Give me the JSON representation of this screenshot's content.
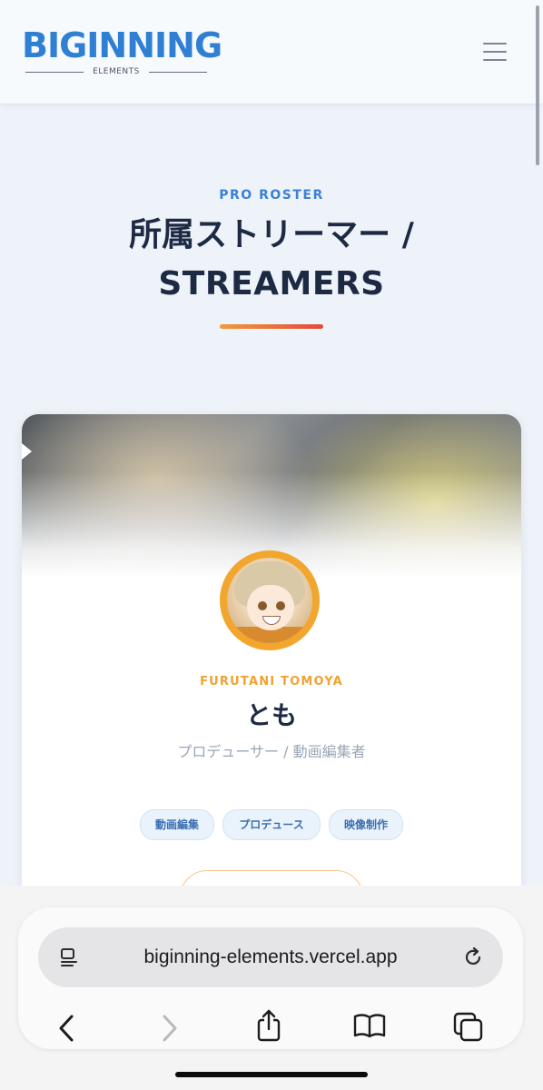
{
  "header": {
    "logo_text": "BIGINNING",
    "logo_sub": "ELEMENTS",
    "menu_icon": "hamburger-icon"
  },
  "section": {
    "eyebrow": "PRO ROSTER",
    "title_line1": "所属ストリーマー /",
    "title_line2": "STREAMERS"
  },
  "card": {
    "romaji": "FURUTANI TOMOYA",
    "name": "とも",
    "role": "プロデューサー / 動画編集者",
    "tags": [
      "動画編集",
      "プロデュース",
      "映像制作"
    ],
    "accent_color": "#f0a232"
  },
  "browser": {
    "url": "biginning-elements.vercel.app",
    "icons": [
      "reader-icon",
      "reload-icon",
      "back-icon",
      "forward-icon",
      "share-icon",
      "bookmarks-icon",
      "tabs-icon"
    ]
  },
  "colors": {
    "brand": "#2f7fd3",
    "title": "#1d2a44",
    "gradient_start": "#f39a3a",
    "gradient_end": "#e24a3c"
  }
}
